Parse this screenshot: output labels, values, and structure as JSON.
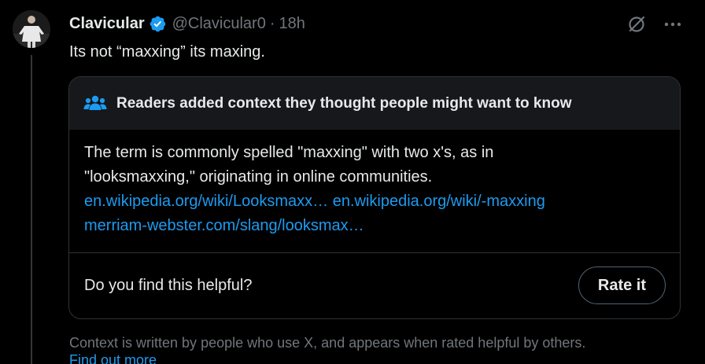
{
  "tweet": {
    "author_name": "Clavicular",
    "handle": "@Clavicular0",
    "separator": "·",
    "time": "18h",
    "text": "Its not “maxxing” its maxing."
  },
  "note": {
    "title": "Readers added context they thought people might want to know",
    "body_line1": "The term is commonly spelled \"maxxing\" with two x's, as in",
    "body_line2": "\"looksmaxxing,\" originating in online communities.",
    "links": [
      "en.wikipedia.org/wiki/Looksmaxx…",
      "en.wikipedia.org/wiki/-maxxing",
      "merriam-webster.com/slang/looksmax…"
    ],
    "helpful_question": "Do you find this helpful?",
    "rate_label": "Rate it"
  },
  "footer": {
    "text": "Context is written by people who use X, and appears when rated helpful by others.",
    "link": "Find out more"
  },
  "colors": {
    "background": "#000000",
    "text": "#e7e9ea",
    "muted": "#71767b",
    "link": "#1d9bf0",
    "border": "#2f3336",
    "verified": "#1d9bf0"
  }
}
